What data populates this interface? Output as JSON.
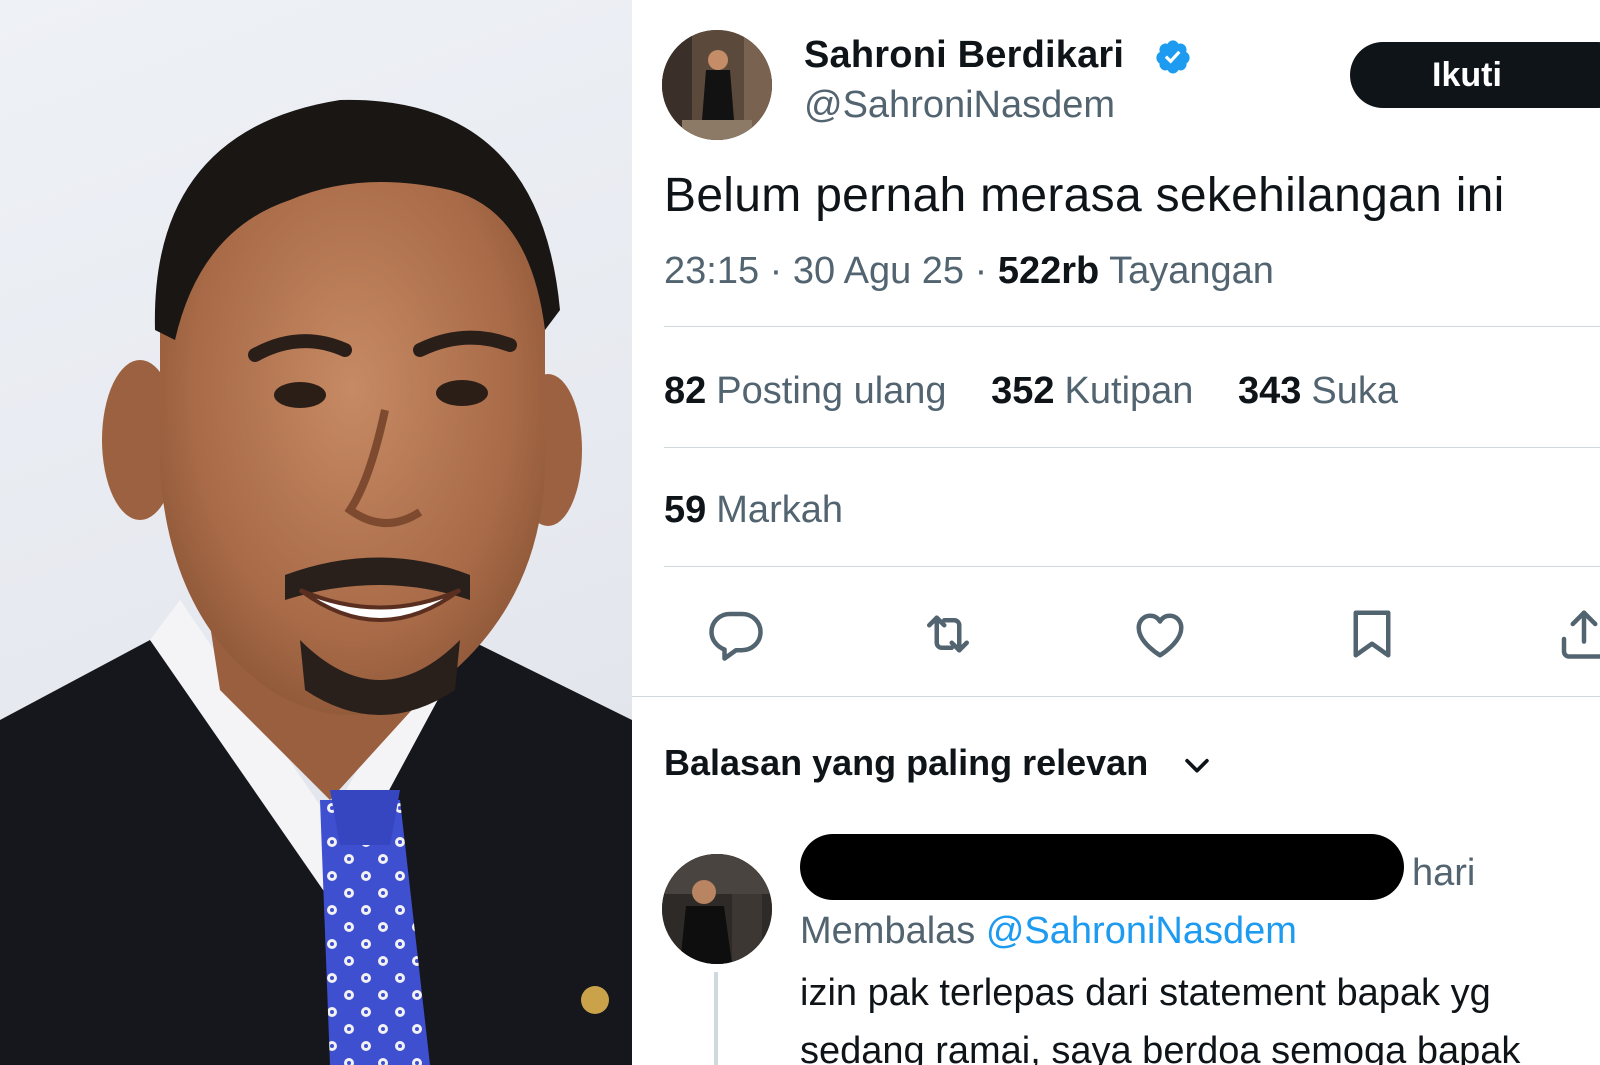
{
  "tweet": {
    "author": {
      "display_name": "Sahroni Berdikari",
      "handle": "@SahroniNasdem",
      "verified": true,
      "avatar_icon": "profile-photo"
    },
    "follow_label": "Ikuti",
    "text": "Belum pernah merasa sekehilangan ini",
    "time": "23:15",
    "date": "30 Agu 25",
    "separator": "·",
    "views_count": "522rb",
    "views_label": "Tayangan",
    "stats": {
      "reposts": {
        "count": "82",
        "label": "Posting ulang"
      },
      "quotes": {
        "count": "352",
        "label": "Kutipan"
      },
      "likes": {
        "count": "343",
        "label": "Suka"
      },
      "bookmarks": {
        "count": "59",
        "label": "Markah"
      }
    },
    "actions": [
      "reply-icon",
      "retweet-icon",
      "heart-icon",
      "bookmark-icon",
      "share-icon"
    ]
  },
  "replies": {
    "sort_label": "Balasan yang paling relevan",
    "first_reply": {
      "time_suffix": "hari",
      "replying_prefix": "Membalas",
      "replying_to": "@SahroniNasdem",
      "text_line_1": "izin pak terlepas dari statement bapak yg",
      "text_line_2": "sedang ramai, saya berdoa semoga bapak"
    }
  },
  "colors": {
    "text_primary": "#0f1419",
    "text_secondary": "#536471",
    "accent": "#1d9bf0",
    "divider": "#cfd9de",
    "follow_bg": "#0f1419"
  }
}
